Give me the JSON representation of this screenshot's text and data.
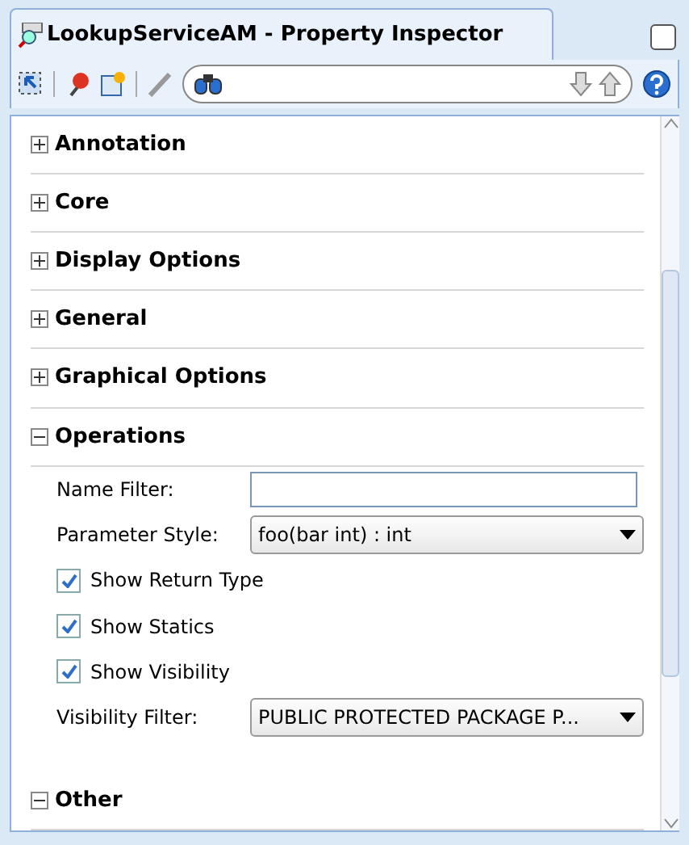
{
  "window": {
    "title": "LookupServiceAM - Property Inspector"
  },
  "sections": [
    {
      "label": "Annotation",
      "expanded": false
    },
    {
      "label": "Core",
      "expanded": false
    },
    {
      "label": "Display Options",
      "expanded": false
    },
    {
      "label": "General",
      "expanded": false
    },
    {
      "label": "Graphical Options",
      "expanded": false
    },
    {
      "label": "Operations",
      "expanded": true,
      "fields": [
        {
          "kind": "text",
          "label": "Name Filter:"
        },
        {
          "kind": "select",
          "label": "Parameter Style:",
          "value": "foo(bar int) : int"
        },
        {
          "kind": "checkbox",
          "label": "Show Return Type",
          "checked": true
        },
        {
          "kind": "checkbox",
          "label": "Show Statics",
          "checked": true
        },
        {
          "kind": "checkbox",
          "label": "Show Visibility",
          "checked": true
        },
        {
          "kind": "select",
          "label": "Visibility Filter:",
          "value": "PUBLIC PROTECTED PACKAGE P..."
        }
      ]
    },
    {
      "label": "Other",
      "expanded": true
    }
  ]
}
